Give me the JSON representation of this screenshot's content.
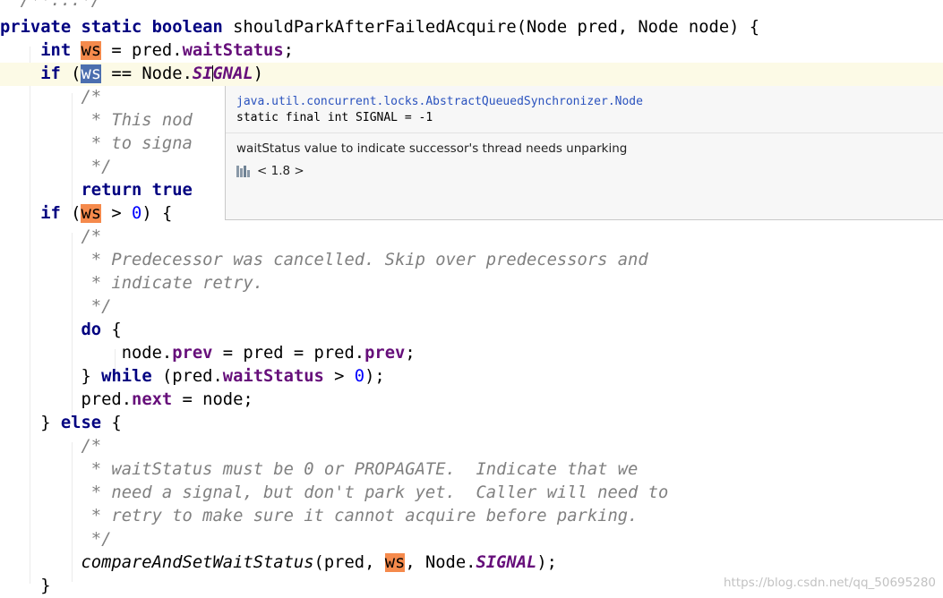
{
  "editor": {
    "folded_doc": "/**...*/",
    "method_sig": {
      "modifiers": "private static boolean",
      "name": "shouldParkAfterFailedAcquire",
      "params": "(Node pred, Node node) {"
    },
    "line_int_ws": {
      "type": "int",
      "var": "ws",
      "assign": " = pred.",
      "field": "waitStatus",
      "end": ";"
    },
    "line_if_signal": {
      "kw": "if",
      "open": " (",
      "var": "ws",
      "op": " == Node.",
      "const_a": "SI",
      "const_b": "GNAL",
      "close": ")"
    },
    "comment1": [
      "/*",
      " * This nod",
      " * to signa",
      " */"
    ],
    "line_return": {
      "kw": "return",
      "val": "true"
    },
    "line_if_gt": {
      "kw": "if",
      "open": " (",
      "var": "ws",
      "op": " > ",
      "num": "0",
      "close": ") {"
    },
    "comment2": [
      "/*",
      " * Predecessor was cancelled. Skip over predecessors and",
      " * indicate retry.",
      " */"
    ],
    "line_do": {
      "kw": "do",
      "rest": " {"
    },
    "line_node_prev": {
      "a": "node.",
      "f1": "prev",
      "b": " = pred = pred.",
      "f2": "prev",
      "c": ";"
    },
    "line_while": {
      "a": "} ",
      "kw": "while",
      "b": " (pred.",
      "f": "waitStatus",
      "c": " > ",
      "num": "0",
      "d": ");"
    },
    "line_pred_next": {
      "a": "pred.",
      "f": "next",
      "b": " = node;"
    },
    "line_else": {
      "a": "} ",
      "kw": "else",
      "b": " {"
    },
    "comment3": [
      "/*",
      " * waitStatus must be 0 or PROPAGATE.  Indicate that we",
      " * need a signal, but don't park yet.  Caller will need to",
      " * retry to make sure it cannot acquire before parking.",
      " */"
    ],
    "line_cas": {
      "method": "compareAndSetWaitStatus",
      "a": "(pred, ",
      "var": "ws",
      "b": ", Node.",
      "const": "SIGNAL",
      "c": ");"
    },
    "closing_brace": "}"
  },
  "quick_doc": {
    "class_path": "java.util.concurrent.locks.AbstractQueuedSynchronizer.Node",
    "declaration": "static final int SIGNAL = -1",
    "description": "waitStatus value to indicate successor's thread needs unparking",
    "library_icon": "library-icon",
    "library": "< 1.8 >"
  },
  "watermark": "https://blog.csdn.net/qq_50695280",
  "colors": {
    "keyword": "#000080",
    "field": "#660e7a",
    "number": "#0000ff",
    "comment": "#808080",
    "write_highlight": "#f58a4c",
    "read_highlight": "#4b6eaf",
    "popup_class_link": "#2a52be"
  }
}
